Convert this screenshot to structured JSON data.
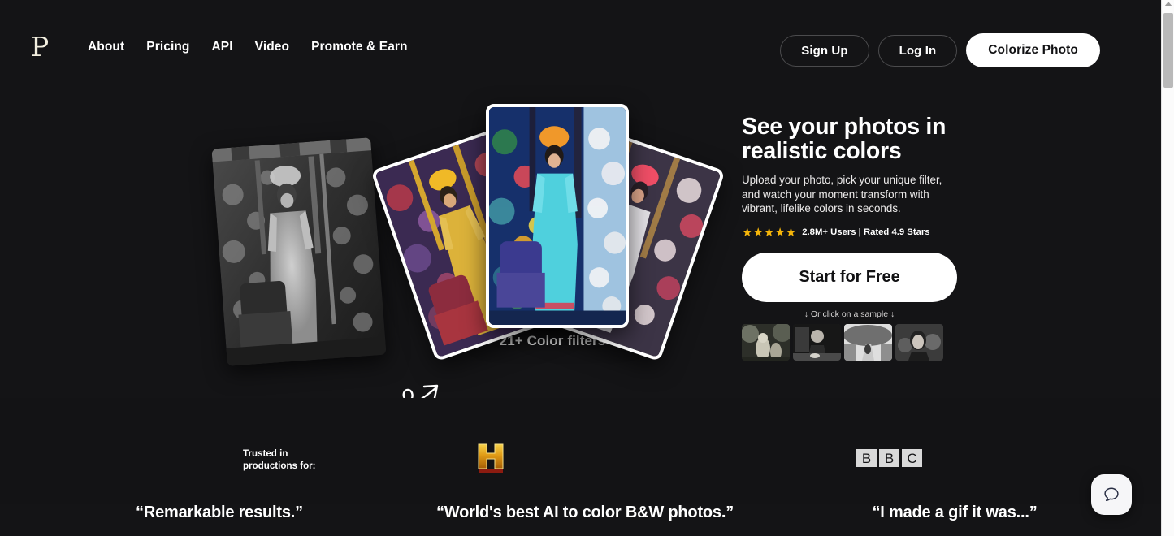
{
  "header": {
    "logo": "P",
    "nav": [
      {
        "label": "About"
      },
      {
        "label": "Pricing"
      },
      {
        "label": "API"
      },
      {
        "label": "Video"
      },
      {
        "label": "Promote & Earn"
      }
    ],
    "sign_up": "Sign Up",
    "log_in": "Log In",
    "colorize_photo": "Colorize Photo"
  },
  "hero": {
    "title": "See your photos in realistic colors",
    "subtitle": "Upload your photo, pick your unique filter, and watch your moment transform with vibrant, lifelike colors in seconds.",
    "stars": "★★★★★",
    "rating_text": "2.8M+ Users | Rated 4.9 Stars",
    "cta": "Start for Free",
    "sample_hint": "↓ Or click on a sample ↓",
    "filters_label": "21+ Color filters",
    "samples": [
      {
        "name": "sample-1-children-outdoors"
      },
      {
        "name": "sample-2-man-at-desk"
      },
      {
        "name": "sample-3-garden-path"
      },
      {
        "name": "sample-4-woman-portrait"
      }
    ]
  },
  "trusted": {
    "label": "Trusted in productions for:",
    "logos": [
      {
        "name": "history-channel",
        "text": "H"
      },
      {
        "name": "bbc",
        "letters": [
          "B",
          "B",
          "C"
        ]
      }
    ]
  },
  "testimonials": [
    {
      "text": "“Remarkable results.”"
    },
    {
      "text": "“World's best AI to color B&W photos.”"
    },
    {
      "text": "“I made a gif it was...”"
    }
  ],
  "chat": {
    "icon": "chat-bubble-icon"
  },
  "colors": {
    "background": "#141416",
    "accent_white": "#ffffff",
    "star_gold": "#f5b50a",
    "logo_cream": "#f3efdf"
  }
}
